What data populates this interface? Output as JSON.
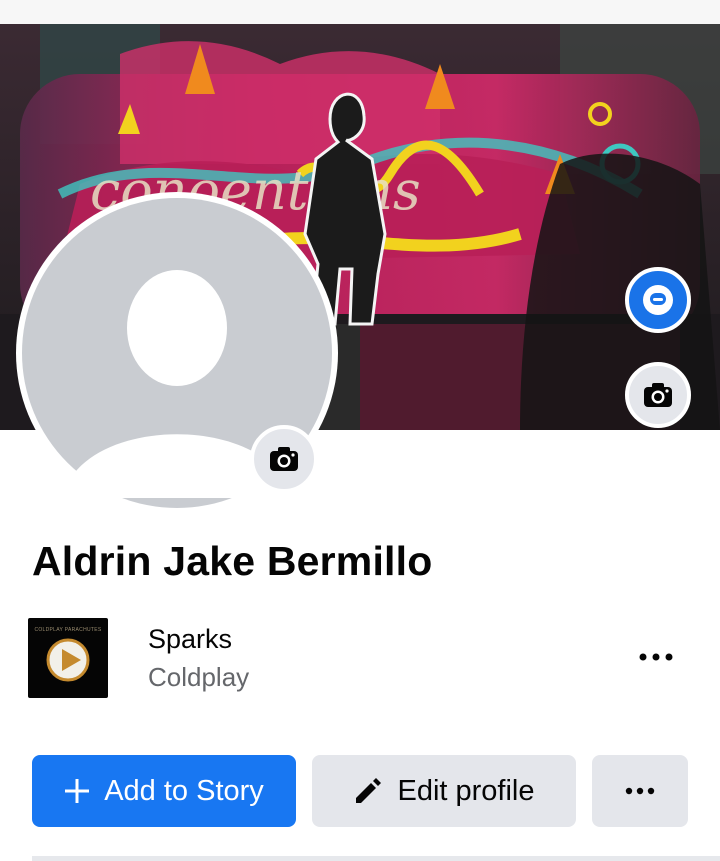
{
  "profile": {
    "name": "Aldrin Jake Bermillo"
  },
  "music": {
    "song": "Sparks",
    "artist": "Coldplay",
    "album_caption": "COLDPLAY PARACHUTES"
  },
  "actions": {
    "add_story_label": "Add to Story",
    "edit_profile_label": "Edit profile"
  },
  "icons": {
    "avatar_button": "avatar-icon",
    "cover_camera": "camera-icon",
    "profile_camera": "camera-icon",
    "music_more": "more-horizontal-icon",
    "add_story": "plus-icon",
    "edit_profile": "pencil-icon",
    "more_button": "more-horizontal-icon"
  },
  "colors": {
    "primary_blue": "#1877f2",
    "secondary_gray": "#e4e6eb",
    "text_primary": "#050505",
    "text_secondary": "#65676b"
  }
}
